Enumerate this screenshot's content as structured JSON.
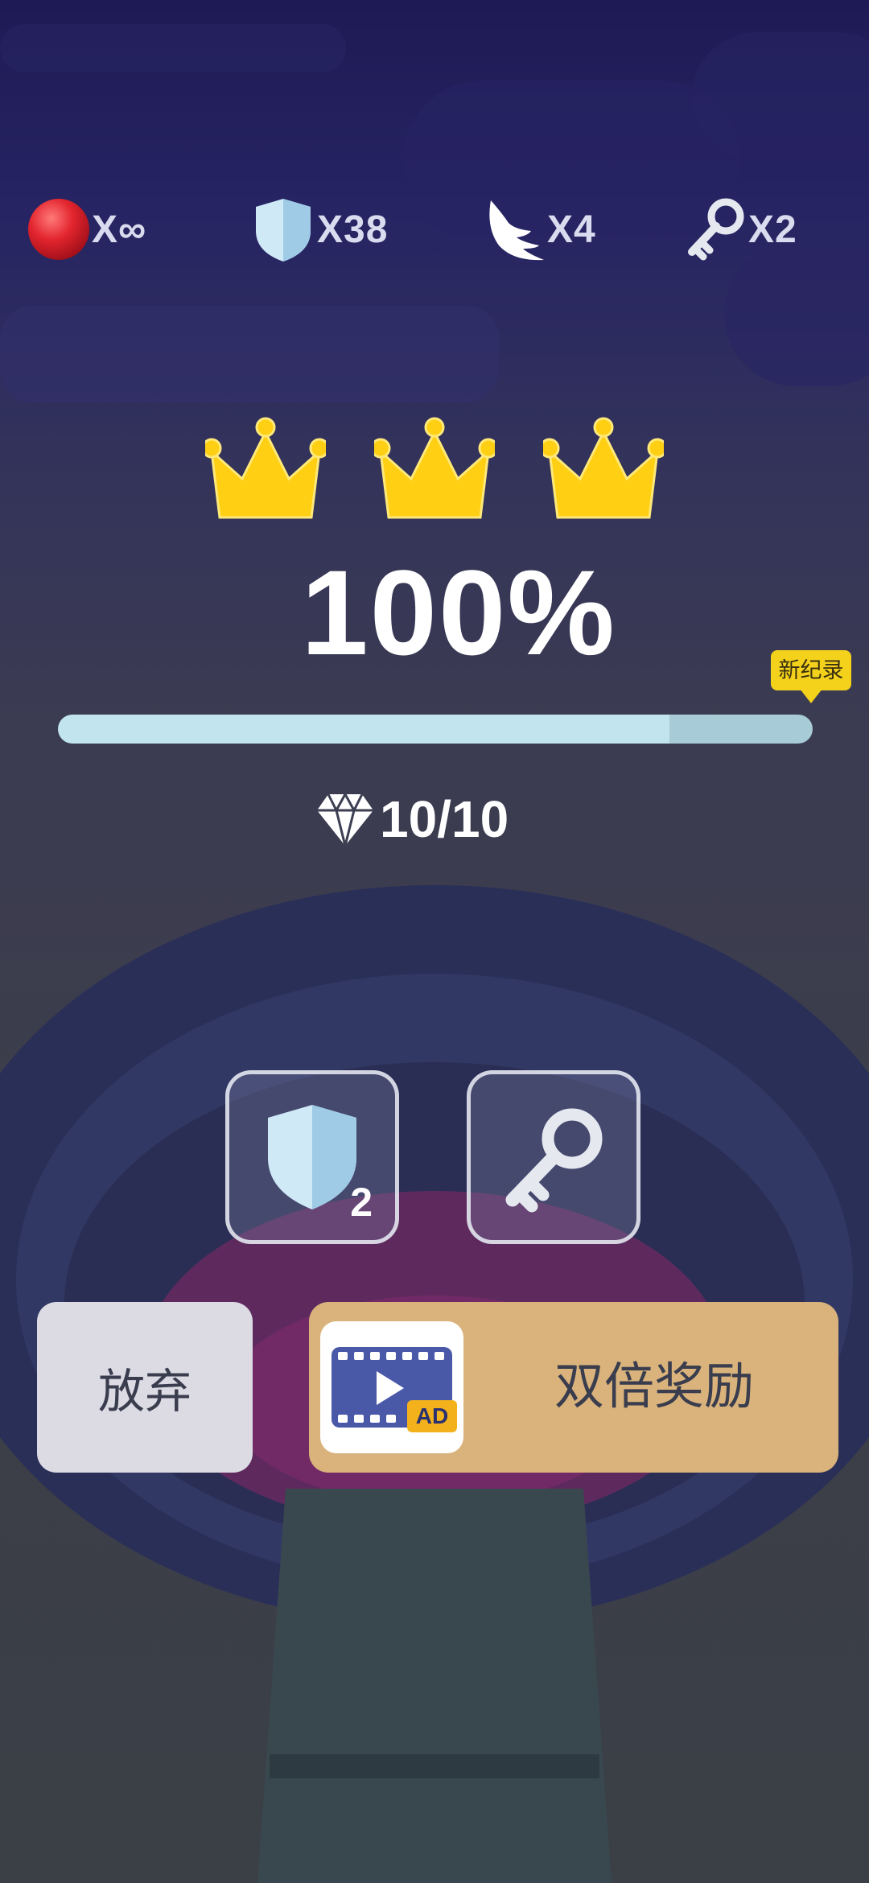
{
  "stats": {
    "lives": "X∞",
    "shields": "X38",
    "wings": "X4",
    "keys": "X2"
  },
  "result": {
    "crowns_earned": 3,
    "percent": "100%",
    "progress": 1.0,
    "best_progress": 0.81,
    "new_record_badge": "新纪录",
    "gems": "10/10"
  },
  "powerups": {
    "shield_count": "2"
  },
  "buttons": {
    "give_up": "放弃",
    "double_reward": "双倍奖励",
    "ad_tag": "AD"
  },
  "colors": {
    "ball": "#e3252e",
    "shield": "#b9dcef",
    "crown": "#ffcf14",
    "progress_fill": "#c1e4ee",
    "badge": "#f4d21c",
    "double_button": "#d9b37b",
    "ad_icon": "#4a58a8"
  },
  "icons": [
    "red-ball-icon",
    "shield-icon",
    "wing-icon",
    "key-icon",
    "crown-icon",
    "diamond-icon",
    "video-ad-icon"
  ]
}
